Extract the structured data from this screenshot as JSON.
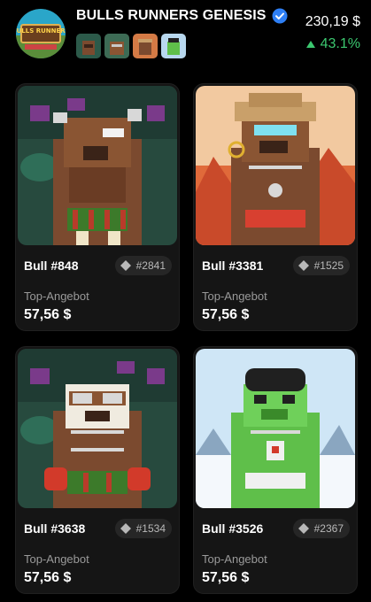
{
  "collection": {
    "logo_text": "BULLS RUNNERS",
    "title": "BULLS RUNNERS GENESIS",
    "floor_price": "230,19 $",
    "change": "43.1%",
    "accent_green": "#3cc870",
    "verified_color": "#2e7ff5"
  },
  "cards": [
    {
      "name": "Bull #848",
      "rank": "#2841",
      "offer_label": "Top-Angebot",
      "offer_value": "57,56 $"
    },
    {
      "name": "Bull #3381",
      "rank": "#1525",
      "offer_label": "Top-Angebot",
      "offer_value": "57,56 $"
    },
    {
      "name": "Bull #3638",
      "rank": "#1534",
      "offer_label": "Top-Angebot",
      "offer_value": "57,56 $"
    },
    {
      "name": "Bull #3526",
      "rank": "#2367",
      "offer_label": "Top-Angebot",
      "offer_value": "57,56 $"
    }
  ]
}
